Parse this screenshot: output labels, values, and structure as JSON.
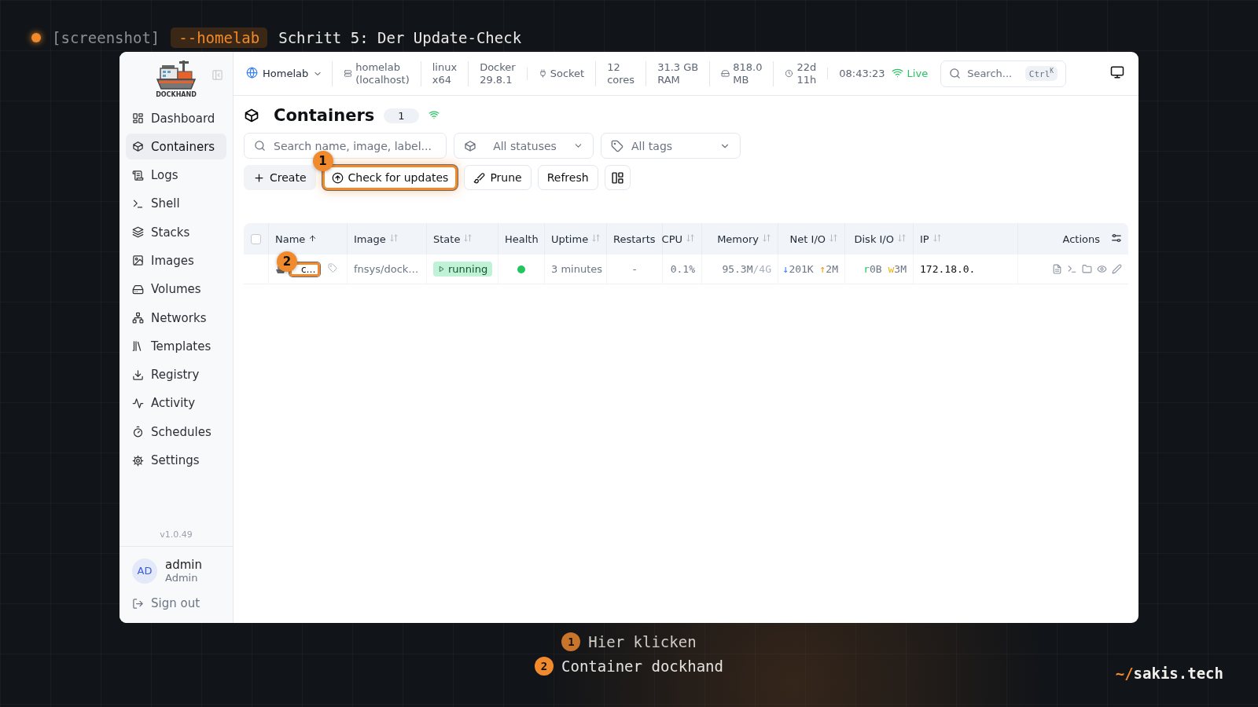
{
  "slide": {
    "tag": "[screenshot]",
    "chip": "--homelab",
    "title": "Schritt 5: Der Update-Check"
  },
  "sidebar": {
    "logo_text": "DOCKHAND",
    "items": [
      {
        "label": "Dashboard",
        "selected": false
      },
      {
        "label": "Containers",
        "selected": true
      },
      {
        "label": "Logs",
        "selected": false
      },
      {
        "label": "Shell",
        "selected": false
      },
      {
        "label": "Stacks",
        "selected": false
      },
      {
        "label": "Images",
        "selected": false
      },
      {
        "label": "Volumes",
        "selected": false
      },
      {
        "label": "Networks",
        "selected": false
      },
      {
        "label": "Templates",
        "selected": false
      },
      {
        "label": "Registry",
        "selected": false
      },
      {
        "label": "Activity",
        "selected": false
      },
      {
        "label": "Schedules",
        "selected": false
      },
      {
        "label": "Settings",
        "selected": false
      }
    ],
    "version": "v1.0.49",
    "user": {
      "initials": "AD",
      "name": "admin",
      "role": "Admin"
    },
    "sign_out": "Sign out"
  },
  "topbar": {
    "environment": "Homelab",
    "stats": [
      {
        "lines": [
          "homelab",
          "(localhost)"
        ]
      },
      {
        "lines": [
          "linux",
          "x64"
        ]
      },
      {
        "lines": [
          "Docker",
          "29.8.1"
        ]
      },
      {
        "lines": [
          "Socket"
        ]
      },
      {
        "lines": [
          "12",
          "cores"
        ]
      },
      {
        "lines": [
          "31.3 GB",
          "RAM"
        ]
      },
      {
        "lines": [
          "818.0",
          "MB"
        ]
      },
      {
        "lines": [
          "22d",
          "11h"
        ]
      }
    ],
    "clock": "08:43:23",
    "live": "Live",
    "search": {
      "placeholder": "Search...",
      "shortcut": "Ctrl",
      "shortcut_key": "K"
    }
  },
  "page": {
    "title": "Containers",
    "count": "1",
    "filters": {
      "search_placeholder": "Search name, image, label...",
      "status": "All statuses",
      "tags": "All tags"
    },
    "buttons": [
      {
        "label": "Create",
        "kind": "create"
      },
      {
        "label": "Check for updates",
        "kind": "update",
        "callout": "1"
      },
      {
        "label": "Prune",
        "kind": "prune"
      },
      {
        "label": "Refresh",
        "kind": "plain"
      },
      {
        "kind": "layout"
      }
    ]
  },
  "table": {
    "all_selected": false,
    "columns": [
      {
        "label": "Name",
        "sortable": true,
        "sorted": true
      },
      {
        "label": "Image",
        "sortable": true,
        "sorted": false
      },
      {
        "label": "State",
        "sortable": true,
        "sorted": false
      },
      {
        "label": "Health",
        "sortable": false
      },
      {
        "label": "Uptime",
        "sortable": true,
        "sorted": false
      },
      {
        "label": "Restarts",
        "sortable": false
      },
      {
        "label": "CPU",
        "sortable": true,
        "sorted": false
      },
      {
        "label": "Memory",
        "sortable": true,
        "sorted": false
      },
      {
        "label": "Net I/O",
        "sortable": true,
        "sorted": false
      },
      {
        "label": "Disk I/O",
        "sortable": true,
        "sorted": false
      },
      {
        "label": "IP",
        "sortable": true,
        "sorted": false
      },
      {
        "label": "Actions",
        "sortable": false
      }
    ],
    "rows": [
      {
        "selected": false,
        "name": "c…",
        "callout": "2",
        "image": "fnsys/dock…",
        "state": "running",
        "health_dot": {
          "color": "#22c55e"
        },
        "uptime": "3 minutes",
        "restarts": "-",
        "cpu": "0.1%",
        "memory": "95.3M",
        "memory_limit": "/4G",
        "net": {
          "down_mark": "↓",
          "down": "201K",
          "up_mark": "↑",
          "up": "2M"
        },
        "disk": {
          "read_mark": "r",
          "read": "0B",
          "write_mark": "w",
          "write": "3M"
        },
        "ip": "172.18.0."
      }
    ]
  },
  "captions": [
    {
      "number": "1",
      "text": "Hier klicken"
    },
    {
      "number": "2",
      "text": "Container dockhand"
    }
  ],
  "brand": {
    "prefix": "~/",
    "name": "sakis.tech"
  }
}
